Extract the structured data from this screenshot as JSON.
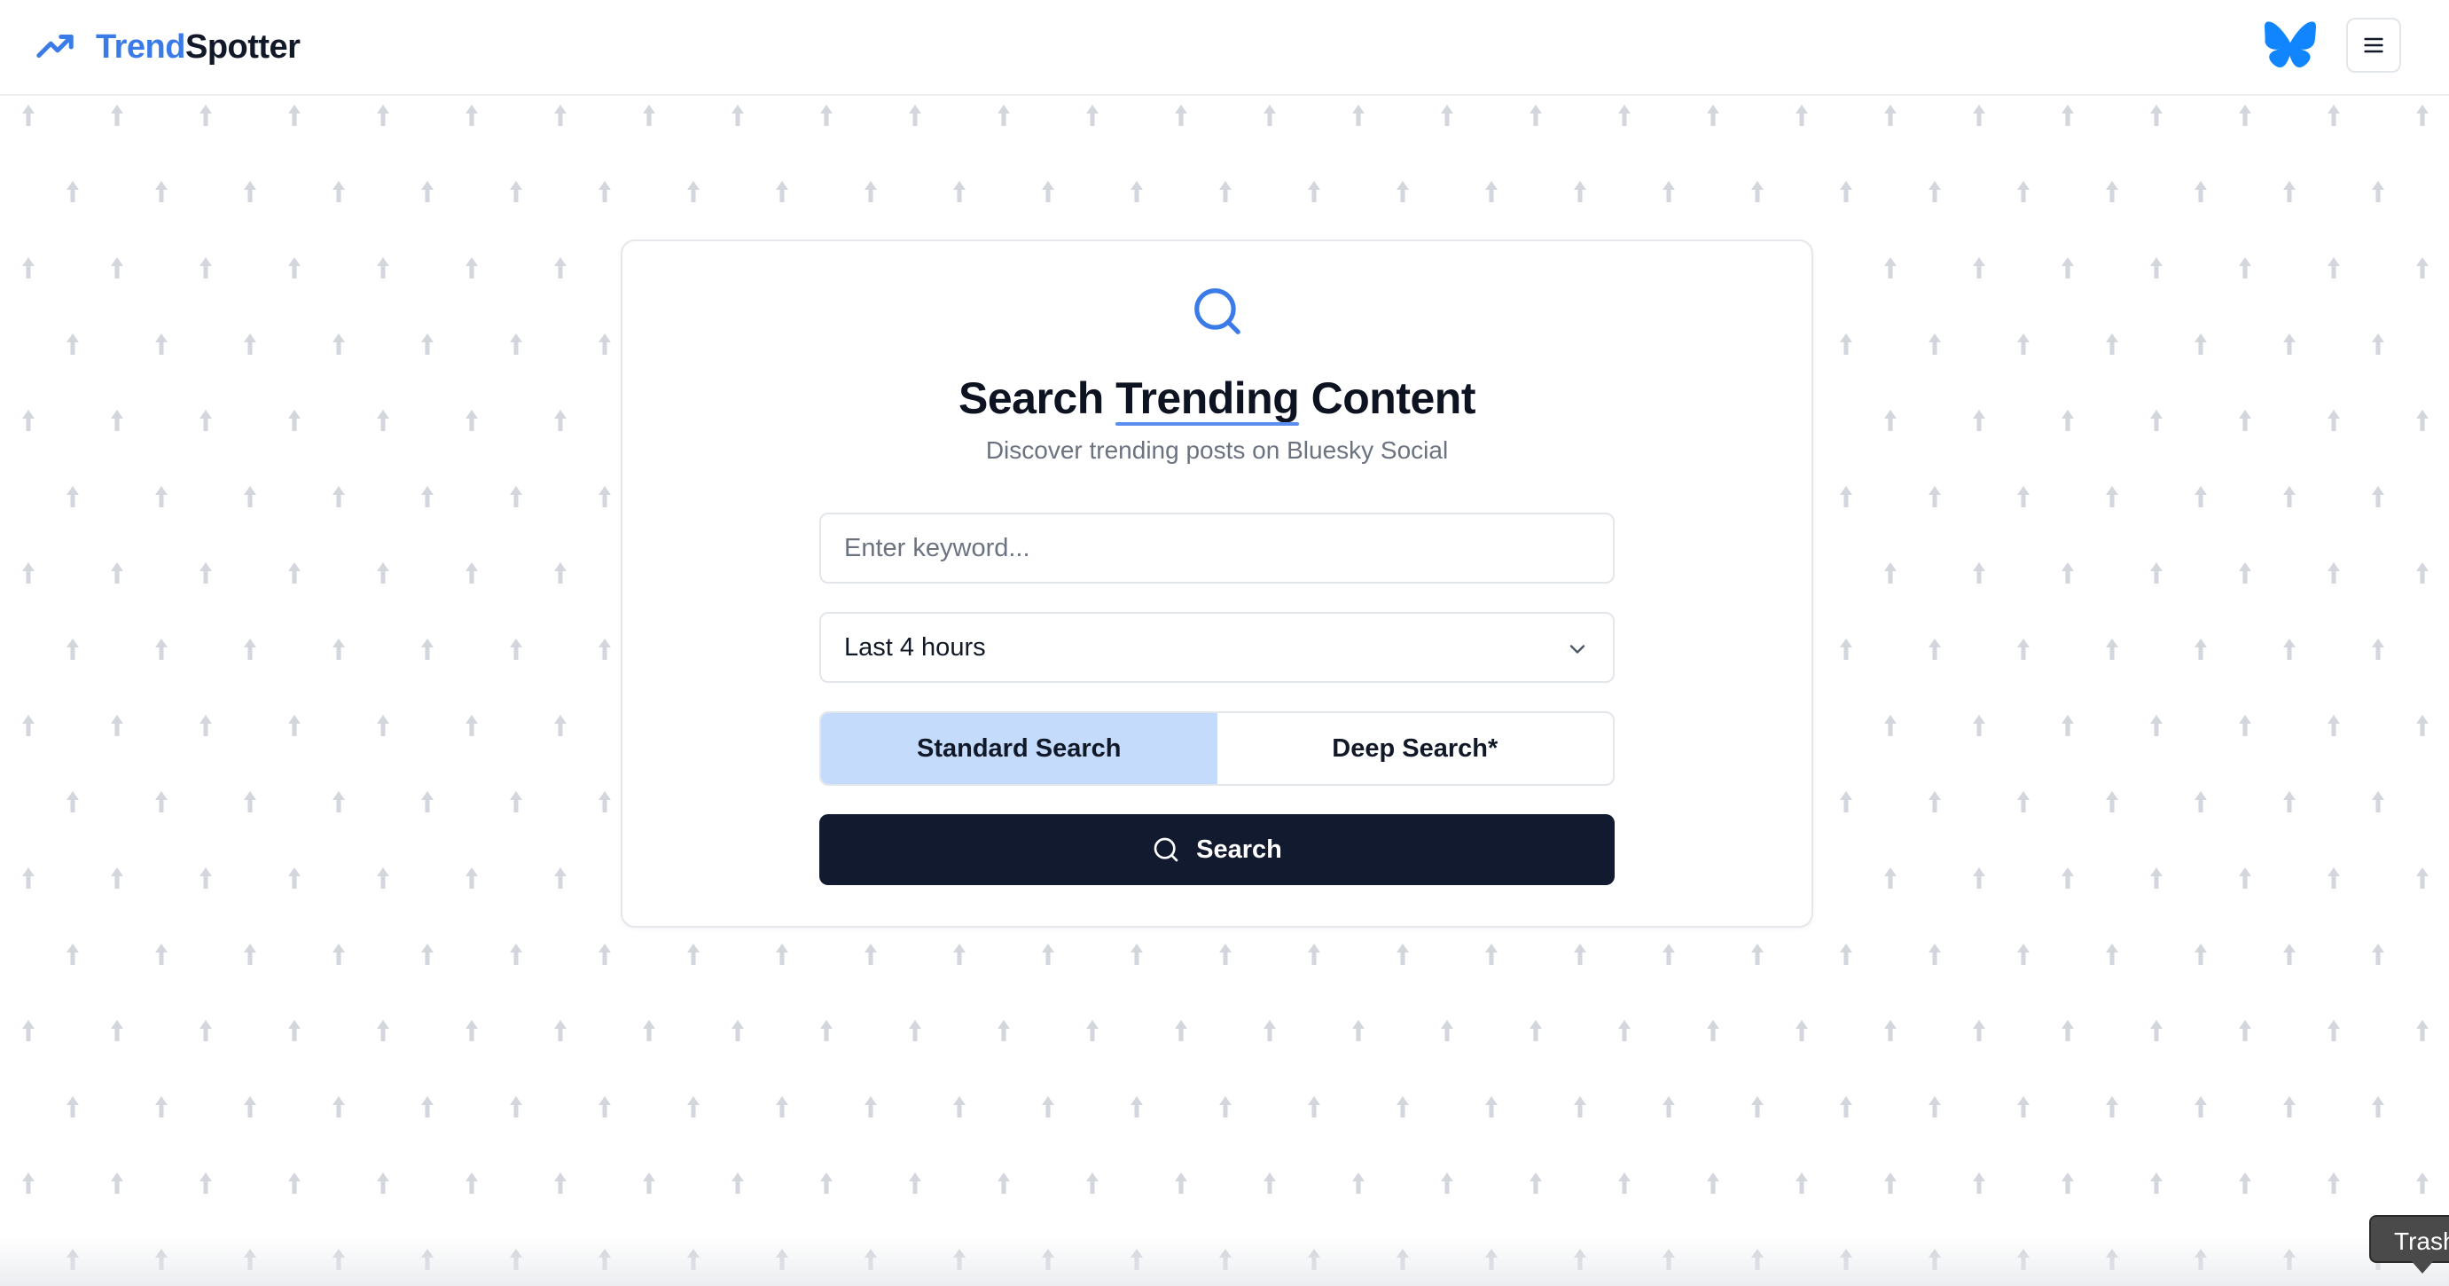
{
  "header": {
    "brand_part1": "Trend",
    "brand_part2": "Spotter",
    "brand_icon": "trending-up-icon",
    "right_icon": "bluesky-butterfly-icon",
    "menu_icon": "hamburger-menu-icon"
  },
  "card": {
    "icon": "search-icon",
    "title_before": "Search ",
    "title_highlight": "Trending",
    "title_after": " Content",
    "subtitle": "Discover trending posts on Bluesky Social",
    "keyword_placeholder": "Enter keyword...",
    "keyword_value": "",
    "time_range_selected": "Last 4 hours",
    "modes": [
      {
        "label": "Standard Search",
        "active": true
      },
      {
        "label": "Deep Search*",
        "active": false
      }
    ],
    "search_button_label": "Search"
  },
  "tooltip": {
    "text": "Trash"
  },
  "colors": {
    "accent": "#3b7be8",
    "button_dark": "#111a2e",
    "mode_active_bg": "#c4dbfb",
    "bluesky": "#1185fe"
  }
}
